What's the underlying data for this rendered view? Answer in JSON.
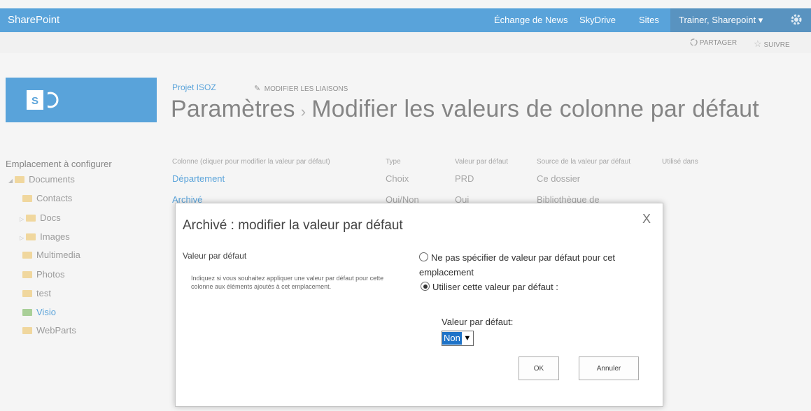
{
  "suite_bar": {
    "brand": "SharePoint",
    "nav": [
      "Échange de News",
      "SkyDrive",
      "Sites"
    ],
    "user": "Trainer, Sharepoint",
    "colors": {
      "suite": "#0072c6",
      "user_box": "#005a9e"
    }
  },
  "ribbon": {
    "share": "PARTAGER",
    "follow": "SUIVRE"
  },
  "site": {
    "name": "Projet ISOZ",
    "edit_links": "MODIFIER LES LIAISONS",
    "logo_letter": "S"
  },
  "title": {
    "part1": "Paramètres",
    "separator": "›",
    "part2": "Modifier les valeurs de colonne par défaut"
  },
  "left_nav": {
    "heading": "Emplacement à configurer",
    "root": "Documents",
    "items": [
      "Contacts",
      "Docs",
      "Images",
      "Multimedia",
      "Photos",
      "test",
      "Visio",
      "WebParts"
    ]
  },
  "table": {
    "headers": [
      "Colonne (cliquer pour modifier la valeur par défaut)",
      "Type",
      "Valeur par défaut",
      "Source de la valeur par défaut",
      "Utilisé dans"
    ],
    "rows": [
      {
        "column": "Département",
        "type": "Choix",
        "value": "PRD",
        "source": "Ce dossier"
      },
      {
        "column": "Archivé",
        "type": "Oui/Non",
        "value": "Oui",
        "source": "Bibliothèque de"
      }
    ]
  },
  "dialog": {
    "title": "Archivé : modifier la valeur par défaut",
    "close": "X",
    "section_title": "Valeur par défaut",
    "section_desc": "Indiquez si vous souhaitez appliquer une valeur par défaut pour cette colonne aux éléments ajoutés à cet emplacement.",
    "option_none": "Ne pas spécifier de valeur par défaut pour cet emplacement",
    "option_use": "Utiliser cette valeur par défaut :",
    "value_label": "Valeur par défaut:",
    "selected_value": "Non",
    "ok": "OK",
    "cancel": "Annuler"
  }
}
